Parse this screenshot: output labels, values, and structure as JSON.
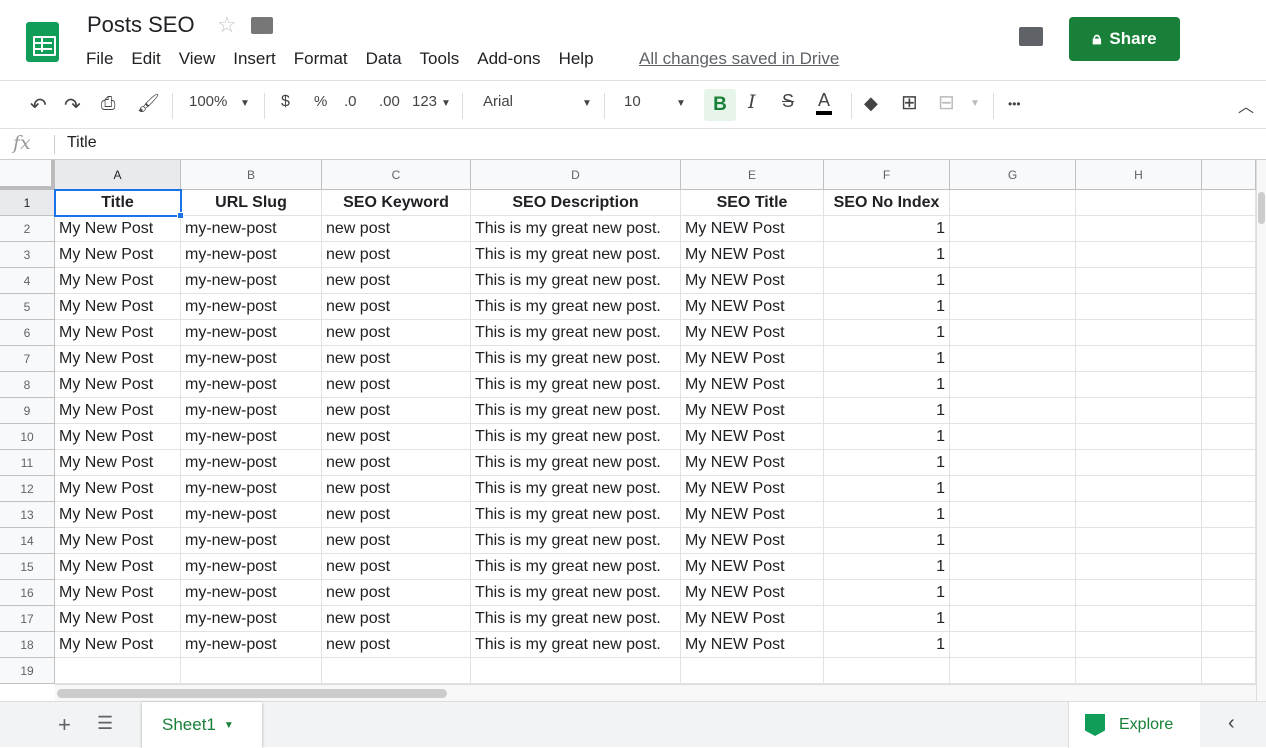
{
  "app": {
    "title": "Posts SEO",
    "menu": [
      "File",
      "Edit",
      "View",
      "Insert",
      "Format",
      "Data",
      "Tools",
      "Add-ons",
      "Help"
    ],
    "saved_status": "All changes saved in Drive",
    "share_label": "Share",
    "accent": "#188038"
  },
  "toolbar": {
    "zoom": "100%",
    "currency": "$",
    "percent": "%",
    "dec_less": ".0",
    "dec_more": ".00",
    "more_formats": "123",
    "font": "Arial",
    "font_size": "10",
    "bold": "B",
    "italic": "I",
    "strike": "S",
    "text_color": "A",
    "more": "•••"
  },
  "formula_bar": {
    "fx": "fx",
    "value": "Title"
  },
  "grid": {
    "columns": [
      "A",
      "B",
      "C",
      "D",
      "E",
      "F",
      "G",
      "H"
    ],
    "header_row": [
      "Title",
      "URL Slug",
      "SEO Keyword",
      "SEO Description",
      "SEO Title",
      "SEO No Index"
    ],
    "rows": [
      [
        "My New Post",
        "my-new-post",
        "new post",
        "This is my great new post.",
        "My NEW Post",
        "1"
      ],
      [
        "My New Post",
        "my-new-post",
        "new post",
        "This is my great new post.",
        "My NEW Post",
        "1"
      ],
      [
        "My New Post",
        "my-new-post",
        "new post",
        "This is my great new post.",
        "My NEW Post",
        "1"
      ],
      [
        "My New Post",
        "my-new-post",
        "new post",
        "This is my great new post.",
        "My NEW Post",
        "1"
      ],
      [
        "My New Post",
        "my-new-post",
        "new post",
        "This is my great new post.",
        "My NEW Post",
        "1"
      ],
      [
        "My New Post",
        "my-new-post",
        "new post",
        "This is my great new post.",
        "My NEW Post",
        "1"
      ],
      [
        "My New Post",
        "my-new-post",
        "new post",
        "This is my great new post.",
        "My NEW Post",
        "1"
      ],
      [
        "My New Post",
        "my-new-post",
        "new post",
        "This is my great new post.",
        "My NEW Post",
        "1"
      ],
      [
        "My New Post",
        "my-new-post",
        "new post",
        "This is my great new post.",
        "My NEW Post",
        "1"
      ],
      [
        "My New Post",
        "my-new-post",
        "new post",
        "This is my great new post.",
        "My NEW Post",
        "1"
      ],
      [
        "My New Post",
        "my-new-post",
        "new post",
        "This is my great new post.",
        "My NEW Post",
        "1"
      ],
      [
        "My New Post",
        "my-new-post",
        "new post",
        "This is my great new post.",
        "My NEW Post",
        "1"
      ],
      [
        "My New Post",
        "my-new-post",
        "new post",
        "This is my great new post.",
        "My NEW Post",
        "1"
      ],
      [
        "My New Post",
        "my-new-post",
        "new post",
        "This is my great new post.",
        "My NEW Post",
        "1"
      ],
      [
        "My New Post",
        "my-new-post",
        "new post",
        "This is my great new post.",
        "My NEW Post",
        "1"
      ],
      [
        "My New Post",
        "my-new-post",
        "new post",
        "This is my great new post.",
        "My NEW Post",
        "1"
      ],
      [
        "My New Post",
        "my-new-post",
        "new post",
        "This is my great new post.",
        "My NEW Post",
        "1"
      ]
    ],
    "row_numbers": [
      "1",
      "2",
      "3",
      "4",
      "5",
      "6",
      "7",
      "8",
      "9",
      "10",
      "11",
      "12",
      "13",
      "14",
      "15",
      "16",
      "17",
      "18",
      "19"
    ],
    "selected_cell": "A1"
  },
  "bottom": {
    "sheet_tab": "Sheet1",
    "explore": "Explore"
  }
}
